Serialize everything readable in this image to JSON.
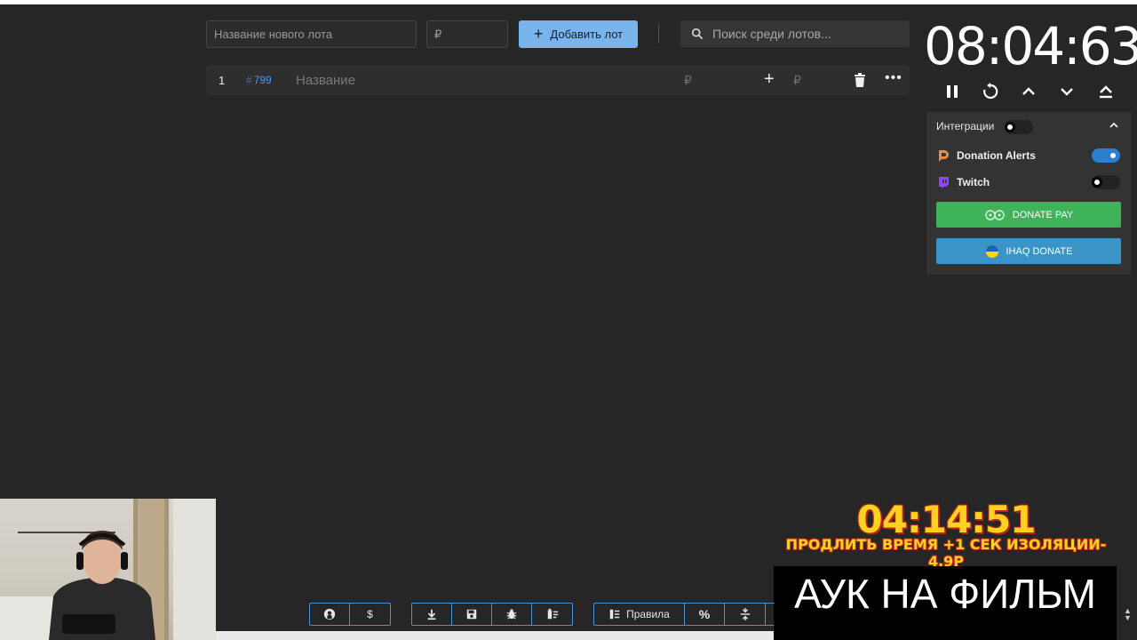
{
  "toolbar": {
    "lot_name_placeholder": "Название нового лота",
    "price_placeholder": "₽",
    "add_lot_label": "Добавить лот",
    "search_placeholder": "Поиск среди лотов..."
  },
  "lots": [
    {
      "index": "1",
      "fast_id_hash": "#",
      "fast_id": "799",
      "name_placeholder": "Название",
      "currency": "₽",
      "add_currency": "₽"
    }
  ],
  "timer": {
    "value": "08:04:63"
  },
  "integrations": {
    "title": "Интеграции",
    "enabled": false,
    "items": [
      {
        "label": "Donation Alerts",
        "enabled": true,
        "icon": "donationalerts-icon"
      },
      {
        "label": "Twitch",
        "enabled": false,
        "icon": "twitch-icon"
      }
    ],
    "donatepay_label": "DONATE PAY",
    "ihaq_label": "IHAQ DONATE"
  },
  "overlay": {
    "timer": "04:14:51",
    "extend_text": "ПРОДЛИТЬ ВРЕМЯ +1 СЕК ИЗОЛЯЦИИ- 4.9Р",
    "title": "АУК НА ФИЛЬМ"
  },
  "bottom_bar": {
    "rules_label": "Правила",
    "percent_label": "%",
    "dollar_label": "$"
  },
  "colors": {
    "background": "#262626",
    "accent": "#7ab4ec",
    "donatepay": "#3eb35a",
    "ihaq": "#3a95c6",
    "overlay_yellow": "#ffd21f"
  }
}
